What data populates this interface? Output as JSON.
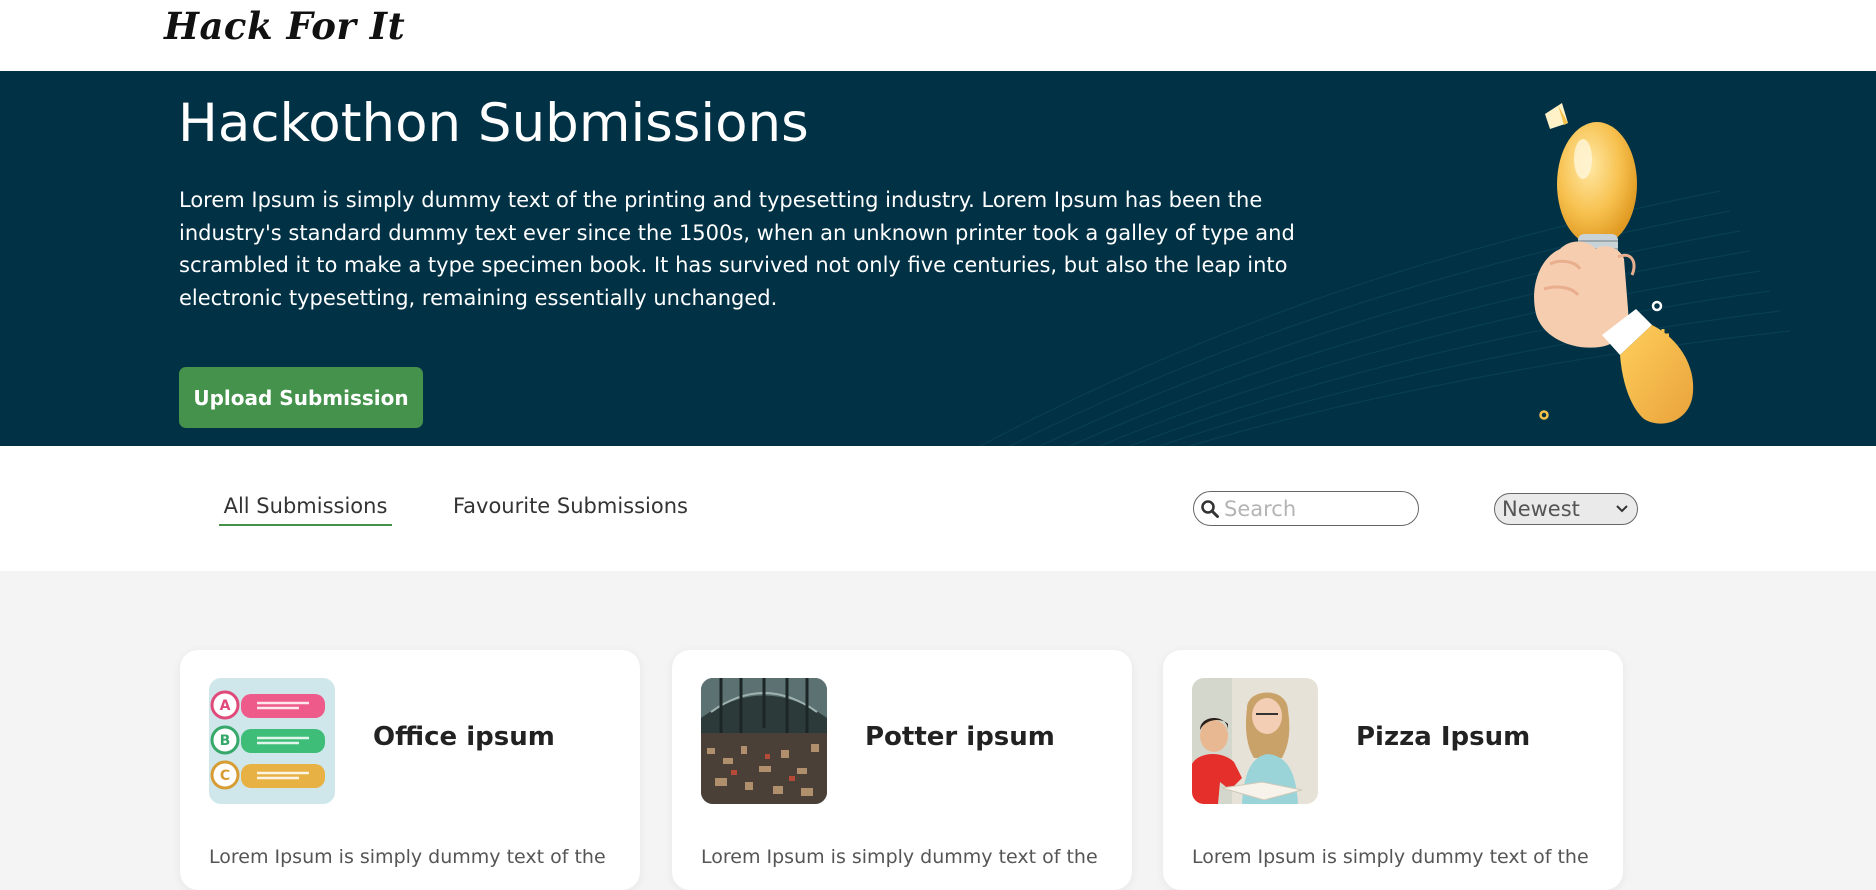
{
  "brand": {
    "logo_text": "Hack For It"
  },
  "hero": {
    "title": "Hackothon Submissions",
    "description": "Lorem Ipsum is simply dummy text of the printing and typesetting industry. Lorem Ipsum has been the industry's standard dummy text ever since the 1500s, when an unknown printer took a galley of type and scrambled it to make a type specimen book. It has survived not only five centuries, but also the leap into electronic typesetting, remaining essentially unchanged.",
    "upload_button": "Upload Submission",
    "background_color": "#003145",
    "button_color": "#44924c"
  },
  "tabs": [
    {
      "label": "All Submissions",
      "active": true
    },
    {
      "label": "Favourite Submissions",
      "active": false
    }
  ],
  "search": {
    "placeholder": "Search",
    "value": "",
    "icon": "search-icon"
  },
  "sort": {
    "selected": "Newest",
    "icon": "chevron-down-icon"
  },
  "cards": [
    {
      "title": "Office ipsum",
      "description": "Lorem Ipsum is simply dummy text of the",
      "thumbnail": "abc-list-image"
    },
    {
      "title": "Potter ipsum",
      "description": "Lorem Ipsum is simply dummy text of the",
      "thumbnail": "market-hall-image"
    },
    {
      "title": "Pizza Ipsum",
      "description": "Lorem Ipsum is simply dummy text of the",
      "thumbnail": "students-image"
    }
  ]
}
